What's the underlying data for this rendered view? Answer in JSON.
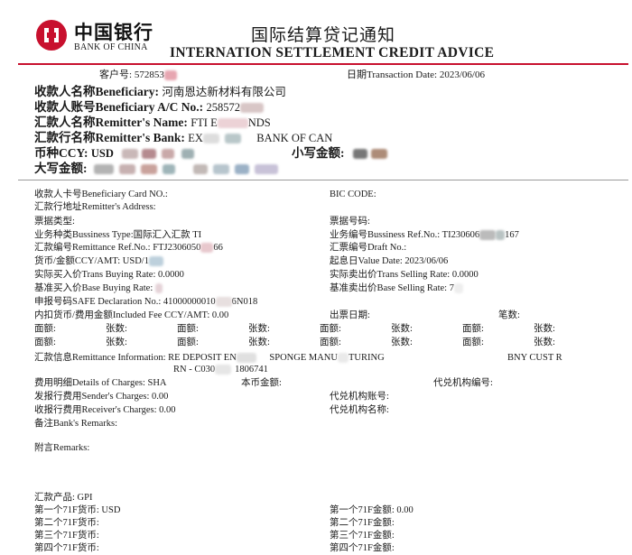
{
  "bank": {
    "name_cn": "中国银行",
    "name_en": "BANK OF CHINA"
  },
  "title": {
    "cn": "国际结算贷记通知",
    "en": "INTERNATION SETTLEMENT CREDIT ADVICE"
  },
  "colors": {
    "brand_red": "#c8102e"
  },
  "top": {
    "customer_no_label": "客户号:",
    "customer_no_value": "572853",
    "date_label": "日期Transaction Date:",
    "date_value": "2023/06/06"
  },
  "main": {
    "beneficiary_label": "收款人名称Beneficiary:",
    "beneficiary_value": "河南恩达新材料有限公司",
    "account_label": "收款人账号Beneficiary A/C No.:",
    "account_value": "258572",
    "remitter_label": "汇款人名称Remitter's Name:",
    "remitter_value_a": "FTI E",
    "remitter_value_b": "NDS",
    "remit_bank_label": "汇款行名称Remitter's Bank:",
    "remit_bank_value_a": "EX",
    "remit_bank_value_b": "BANK OF CAN",
    "ccy_label": "币种CCY:",
    "ccy_value": "USD",
    "small_amount_label": "小写金额:",
    "big_amount_label": "大写金额:"
  },
  "details": {
    "card_no": "收款人卡号Beneficiary Card NO.:",
    "bic": "BIC CODE:",
    "remitter_addr": "汇款行地址Remitter's Address:",
    "bill_type": "票据类型:",
    "bill_no": "票据号码:",
    "biz_type_label": "业务种类Bussiness Type:",
    "biz_type_value": "国际汇入汇款 TI",
    "biz_no_label": "业务编号Bussiness Ref.No.:",
    "biz_no_value_a": "TI230606",
    "biz_no_value_b": "167",
    "remit_ref_label": "汇款编号Remittance Ref.No.:",
    "remit_ref_value_a": "FTJ2306050",
    "remit_ref_value_b": "66",
    "draft_no": "汇票编号Draft No.:",
    "ccy_amt_label": "货币/金额CCY/AMT:",
    "ccy_amt_value": "USD/1",
    "value_date_label": "起息日Value Date:",
    "value_date_value": "2023/06/06",
    "buy_rate_label": "实际买入价Trans Buying Rate:",
    "buy_rate_value": "0.0000",
    "sell_rate_label": "实际卖出价Trans Selling Rate:",
    "sell_rate_value": "0.0000",
    "base_buy_label": "基准买入价Base Buying Rate:",
    "base_buy_value": "",
    "base_sell_label": "基准卖出价Base Selling Rate:",
    "base_sell_value": "7",
    "safe_label": "申报号码SAFE Declaration No.:",
    "safe_value_a": "41000000010",
    "safe_value_b": "6N018",
    "fee_label": "内扣货币/费用金额Included Fee CCY/AMT:",
    "fee_value": "0.00",
    "vote_date": "出票日期:",
    "num_strokes": "笔数:",
    "face_value": "面额:",
    "num_sheets": "张数:",
    "remit_info_label": "汇款信息Remittance Information:",
    "remit_info_a": "RE DEPOSIT EN",
    "remit_info_b": "SPONGE MANU",
    "remit_info_c": "TURING",
    "remit_info_d": "BNY CUST R",
    "remit_info_line2_a": "RN - C030",
    "remit_info_line2_b": "1806741",
    "charges_label": "费用明细Details of Charges:",
    "charges_value": "SHA",
    "local_amount": "本币金额:",
    "agent_no": "代兑机构编号:",
    "sender_chg_label": "发报行费用Sender's Charges:",
    "sender_chg_value": "0.00",
    "agent_acct": "代兑机构账号:",
    "recv_chg_label": "收报行费用Receiver's Charges:",
    "recv_chg_value": "0.00",
    "agent_name": "代兑机构名称:",
    "bank_remarks": "备注Bank's Remarks:",
    "remarks": "附言Remarks:",
    "product_label": "汇款产品:",
    "product_value": "GPI",
    "ccy1_label": "第一个71F货币:",
    "ccy1_value": "USD",
    "amt1_label": "第一个71F金额:",
    "amt1_value": "0.00",
    "ccy2_label": "第二个71F货币:",
    "amt2_label": "第二个71F金额:",
    "ccy3_label": "第三个71F货币:",
    "amt3_label": "第三个71F金额:",
    "ccy4_label": "第四个71F货币:",
    "amt4_label": "第四个71F金额:"
  }
}
